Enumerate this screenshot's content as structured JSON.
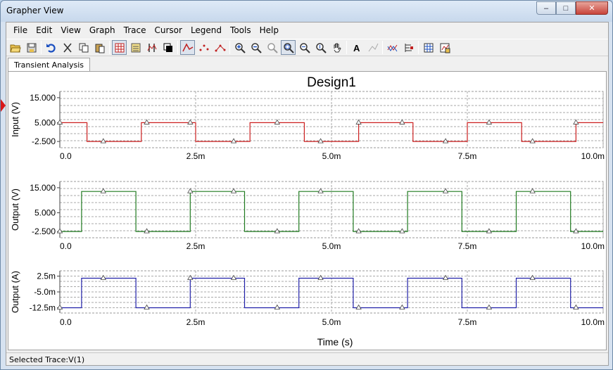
{
  "window": {
    "title": "Grapher View",
    "min": "–",
    "max": "□",
    "close": "✕"
  },
  "menu": [
    "File",
    "Edit",
    "View",
    "Graph",
    "Trace",
    "Cursor",
    "Legend",
    "Tools",
    "Help"
  ],
  "tab": {
    "label": "Transient Analysis"
  },
  "status": {
    "text": "Selected Trace:V(1)"
  },
  "colors": {
    "red": "#cc1f1f",
    "green": "#1f7a1f",
    "blue": "#2020a8"
  },
  "chart_data": [
    {
      "type": "line",
      "title": "Design1",
      "ylabel": "Input (V)",
      "xlabel": "",
      "xlim": [
        0,
        0.01
      ],
      "ylim": [
        -5,
        17.5
      ],
      "yticks": [
        15,
        5,
        -2.5
      ],
      "ytick_labels": [
        "15.000",
        "5.000",
        "-2.500"
      ],
      "xticks": [
        0,
        0.0025,
        0.005,
        0.0075,
        0.01
      ],
      "xtick_labels": [
        "0.0",
        "2.5m",
        "5.0m",
        "7.5m",
        "10.0m"
      ],
      "grid": true,
      "series": [
        {
          "color": "#cc1f1f",
          "high": 5,
          "low": -2.5,
          "transitions": [
            0.0005,
            0.0015,
            0.0025,
            0.0035,
            0.0045,
            0.0055,
            0.0065,
            0.0075,
            0.0085,
            0.0095
          ],
          "start_high": true,
          "marker_x": [
            0,
            0.0008,
            0.0016,
            0.0024,
            0.0032,
            0.004,
            0.0048,
            0.0055,
            0.0063,
            0.0071,
            0.0079,
            0.0087,
            0.0095
          ]
        }
      ]
    },
    {
      "type": "line",
      "title": "",
      "ylabel": "Output (V)",
      "xlabel": "",
      "xlim": [
        0,
        0.01
      ],
      "ylim": [
        -5,
        17.5
      ],
      "yticks": [
        15,
        5,
        -2.5
      ],
      "ytick_labels": [
        "15.000",
        "5.000",
        "-2.500"
      ],
      "xticks": [
        0,
        0.0025,
        0.005,
        0.0075,
        0.01
      ],
      "xtick_labels": [
        "0.0",
        "2.5m",
        "5.0m",
        "7.5m",
        "10.0m"
      ],
      "grid": true,
      "series": [
        {
          "color": "#1f7a1f",
          "high": 13.5,
          "low": -2.5,
          "transitions": [
            0.0004,
            0.0014,
            0.0024,
            0.0034,
            0.0044,
            0.0054,
            0.0064,
            0.0074,
            0.0084,
            0.0094
          ],
          "start_high": false,
          "marker_x": [
            0,
            0.0008,
            0.0016,
            0.0024,
            0.0032,
            0.004,
            0.0048,
            0.0055,
            0.0063,
            0.0071,
            0.0079,
            0.0087,
            0.0095
          ]
        }
      ]
    },
    {
      "type": "line",
      "title": "",
      "ylabel": "Output (A)",
      "xlabel": "Time (s)",
      "xlim": [
        0,
        0.01
      ],
      "ylim": [
        -15,
        5
      ],
      "yticks": [
        2.5,
        -5,
        -12.5
      ],
      "ytick_labels": [
        "2.5m",
        "-5.0m",
        "-12.5m"
      ],
      "xticks": [
        0,
        0.0025,
        0.005,
        0.0075,
        0.01
      ],
      "xtick_labels": [
        "0.0",
        "2.5m",
        "5.0m",
        "7.5m",
        "10.0m"
      ],
      "grid": true,
      "series": [
        {
          "color": "#2020a8",
          "high": 1.5,
          "low": -12.5,
          "transitions": [
            0.0004,
            0.0014,
            0.0024,
            0.0034,
            0.0044,
            0.0054,
            0.0064,
            0.0074,
            0.0084,
            0.0094
          ],
          "start_high": false,
          "marker_x": [
            0,
            0.0008,
            0.0016,
            0.0024,
            0.0032,
            0.004,
            0.0048,
            0.0055,
            0.0063,
            0.0071,
            0.0079,
            0.0087,
            0.0095
          ]
        }
      ]
    }
  ]
}
